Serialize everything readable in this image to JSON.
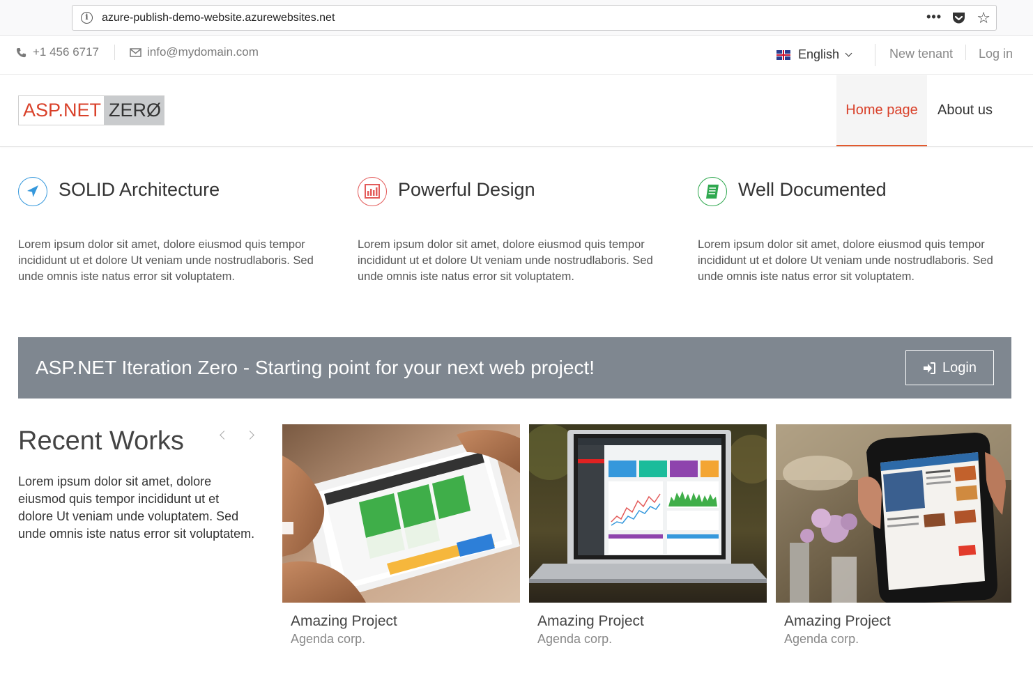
{
  "browser": {
    "url": "azure-publish-demo-website.azurewebsites.net",
    "more_label": "•••"
  },
  "topbar": {
    "phone": "+1 456 6717",
    "email": "info@mydomain.com",
    "language": "English",
    "new_tenant": "New tenant",
    "login": "Log in"
  },
  "header": {
    "logo_left": "ASP.NET",
    "logo_right": "ZERØ",
    "nav": {
      "home": "Home page",
      "about": "About us"
    }
  },
  "features": [
    {
      "title": "SOLID Architecture",
      "icon": "location-arrow-icon",
      "color": "#3598dc",
      "text": "Lorem ipsum dolor sit amet, dolore eiusmod quis tempor incididunt ut et dolore Ut veniam unde nostrudlaboris. Sed unde omnis iste natus error sit voluptatem."
    },
    {
      "title": "Powerful Design",
      "icon": "bar-chart-icon",
      "color": "#e35b5a",
      "text": "Lorem ipsum dolor sit amet, dolore eiusmod quis tempor incididunt ut et dolore Ut veniam unde nostrudlaboris. Sed unde omnis iste natus error sit voluptatem."
    },
    {
      "title": "Well Documented",
      "icon": "book-icon",
      "color": "#2fa84f",
      "text": "Lorem ipsum dolor sit amet, dolore eiusmod quis tempor incididunt ut et dolore Ut veniam unde nostrudlaboris. Sed unde omnis iste natus error sit voluptatem."
    }
  ],
  "banner": {
    "text": "ASP.NET Iteration Zero - Starting point for your next web project!",
    "button": "Login"
  },
  "recent_works": {
    "title": "Recent Works",
    "text": "Lorem ipsum dolor sit amet, dolore eiusmod quis tempor incididunt ut et dolore Ut veniam unde voluptatem. Sed unde omnis iste natus error sit voluptatem.",
    "items": [
      {
        "title": "Amazing Project",
        "subtitle": "Agenda corp."
      },
      {
        "title": "Amazing Project",
        "subtitle": "Agenda corp."
      },
      {
        "title": "Amazing Project",
        "subtitle": "Agenda corp."
      }
    ]
  },
  "colors": {
    "accent": "#d9412a",
    "banner": "#7f8790"
  }
}
